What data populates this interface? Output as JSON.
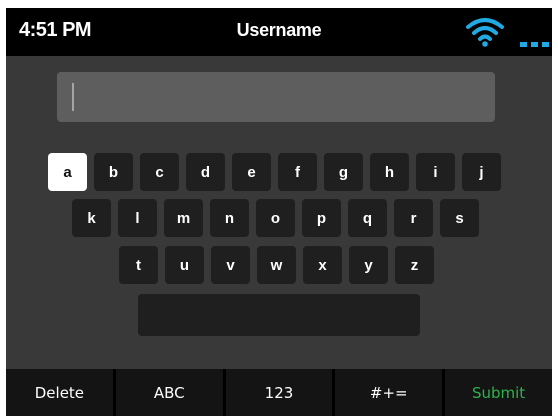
{
  "status_bar": {
    "time": "4:51 PM",
    "title": "Username",
    "wifi_icon": "wifi-icon",
    "more_icon": "more-dots-icon"
  },
  "input": {
    "value": ""
  },
  "keyboard": {
    "rows": [
      [
        "a",
        "b",
        "c",
        "d",
        "e",
        "f",
        "g",
        "h",
        "i",
        "j"
      ],
      [
        "k",
        "l",
        "m",
        "n",
        "o",
        "p",
        "q",
        "r",
        "s"
      ],
      [
        "t",
        "u",
        "v",
        "w",
        "x",
        "y",
        "z"
      ]
    ],
    "active_key": "a"
  },
  "softkeys": [
    "Delete",
    "ABC",
    "123",
    "#+=",
    "Submit"
  ],
  "colors": {
    "accent": "#2fb24c",
    "wifi": "#21a9e3",
    "key_bg": "#1f1f1f",
    "panel_bg": "#393939",
    "active_key_bg": "#ffffff"
  }
}
